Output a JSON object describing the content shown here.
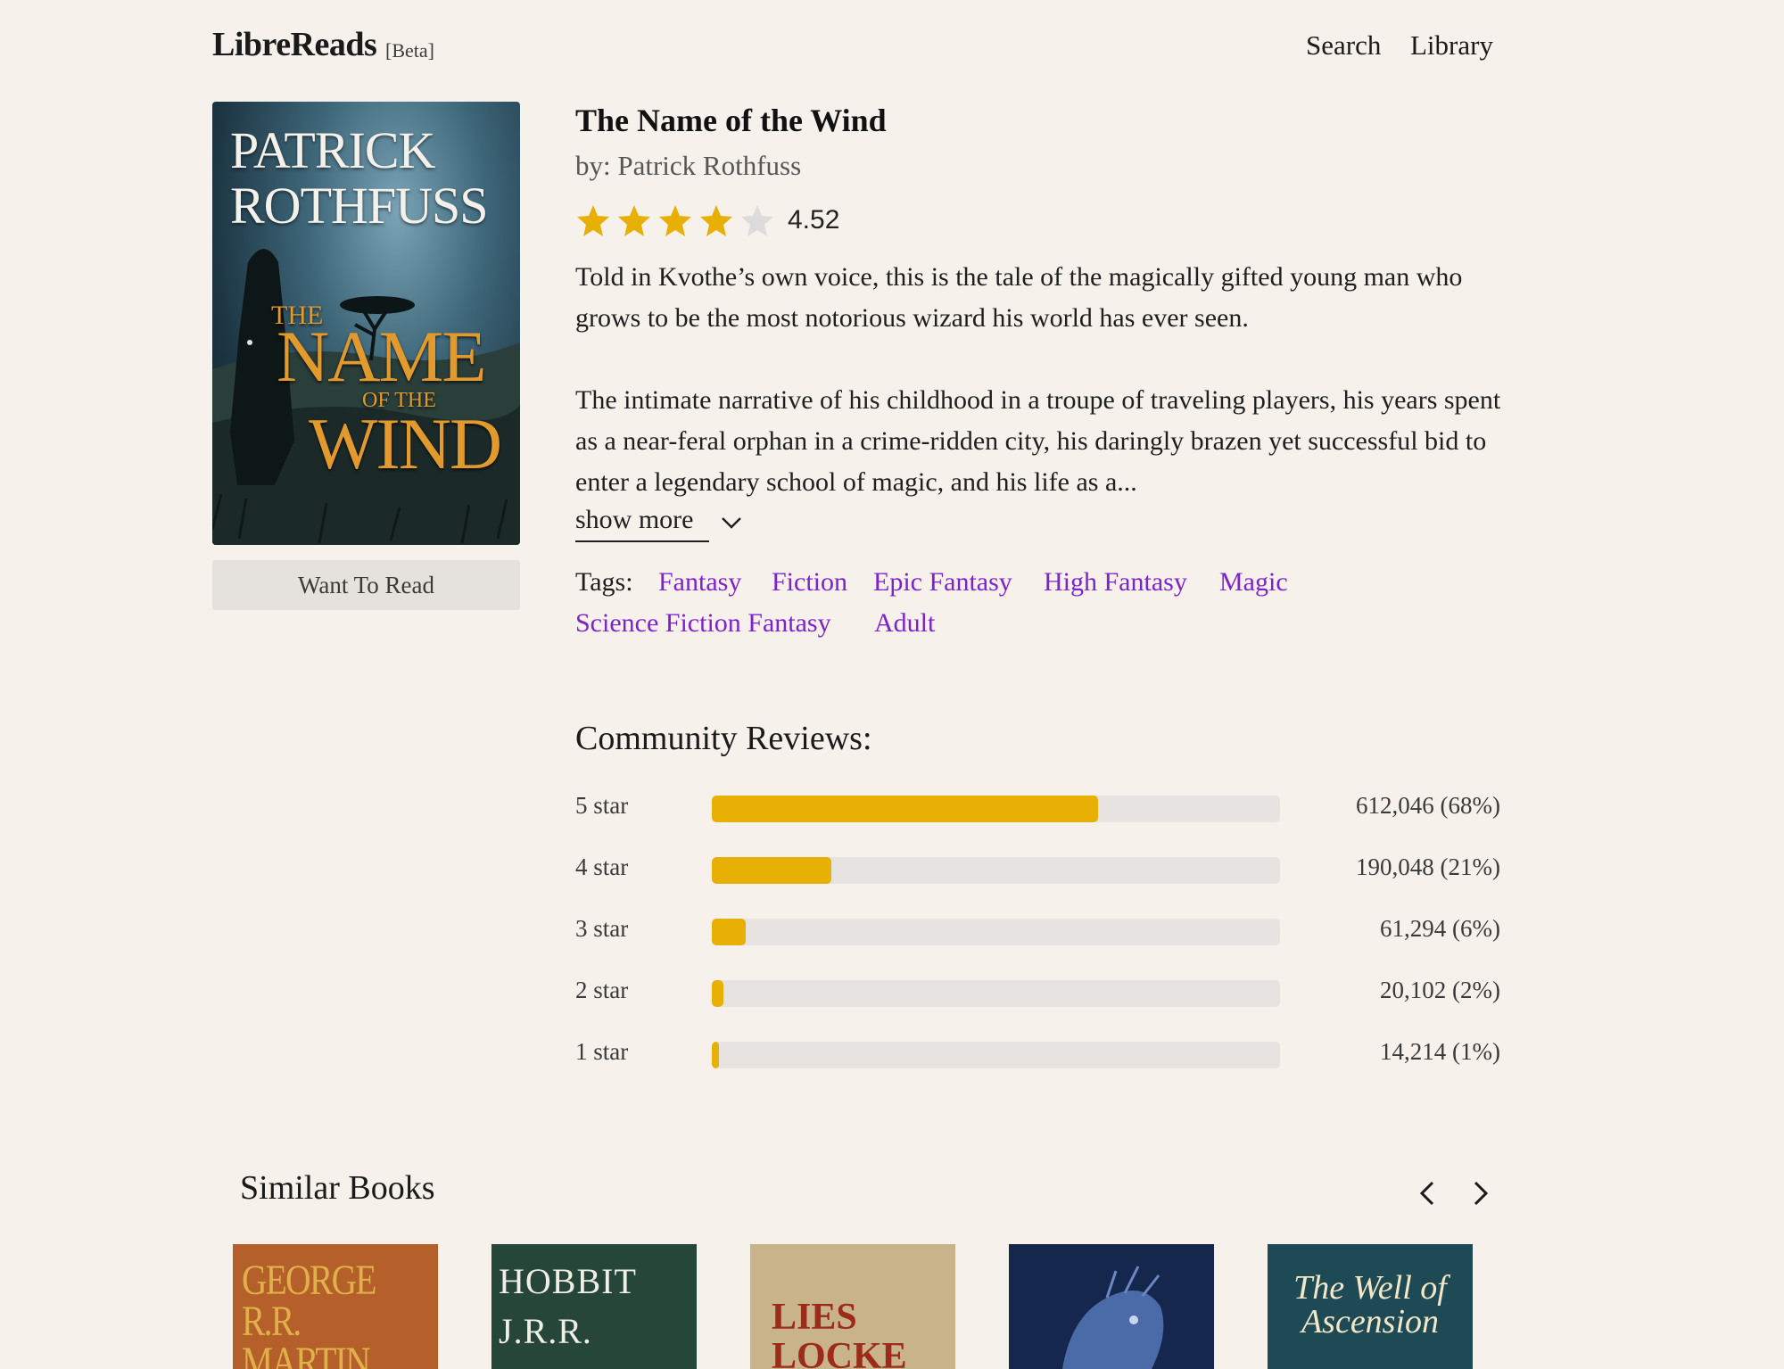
{
  "header": {
    "brand": "LibreReads",
    "beta": "[Beta]",
    "nav": [
      "Search",
      "Library"
    ]
  },
  "cover": {
    "author_line1": "PATRICK",
    "author_line2": "ROTHFUSS",
    "title_the": "THE",
    "title_name": "NAME",
    "title_of": "OF THE",
    "title_wind": "WIND"
  },
  "actions": {
    "want_to_read": "Want To Read"
  },
  "book": {
    "title": "The Name of the Wind",
    "author": "by: Patrick Rothfuss",
    "rating": "4.52",
    "rating_value": 4.52,
    "stars_filled": 4,
    "stars_total": 5,
    "description": [
      "Told in Kvothe’s own voice, this is the tale of the magically gifted young man who grows to be the most notorious wizard his world has ever seen.",
      "The intimate narrative of his childhood in a troupe of traveling players, his years spent as a near-feral orphan in a crime-ridden city, his daringly brazen yet successful bid to enter a legendary school of magic, and his life as a..."
    ],
    "show_more": "show more",
    "tags_label": "Tags:",
    "tags": [
      "Fantasy",
      "Fiction",
      "Epic Fantasy",
      "High Fantasy",
      "Magic",
      "Science Fiction Fantasy",
      "Adult"
    ]
  },
  "reviews": {
    "heading": "Community Reviews:",
    "rows": [
      {
        "label": "5 star",
        "count": "612,046 (68%)",
        "percent": 68
      },
      {
        "label": "4 star",
        "count": "190,048 (21%)",
        "percent": 21
      },
      {
        "label": "3 star",
        "count": "61,294 (6%)",
        "percent": 6
      },
      {
        "label": "2 star",
        "count": "20,102 (2%)",
        "percent": 2
      },
      {
        "label": "1 star",
        "count": "14,214 (1%)",
        "percent": 1
      }
    ]
  },
  "similar": {
    "heading": "Similar Books",
    "books": [
      {
        "cover_text": "GEORGE R.R. MARTIN",
        "color": "#b5602a"
      },
      {
        "cover_text": "HOBBIT J.R.R. TOLKIEN",
        "color": "#27463a"
      },
      {
        "cover_text": "LIES LOCKE",
        "color": "#c9b38a"
      },
      {
        "cover_text": "",
        "color": "#16274e"
      },
      {
        "cover_text": "The Well of Ascension",
        "color": "#1d4a55"
      }
    ]
  },
  "colors": {
    "accent_star": "#e8b004",
    "tag_link": "#7e22ce",
    "background": "#f6f1eb"
  }
}
